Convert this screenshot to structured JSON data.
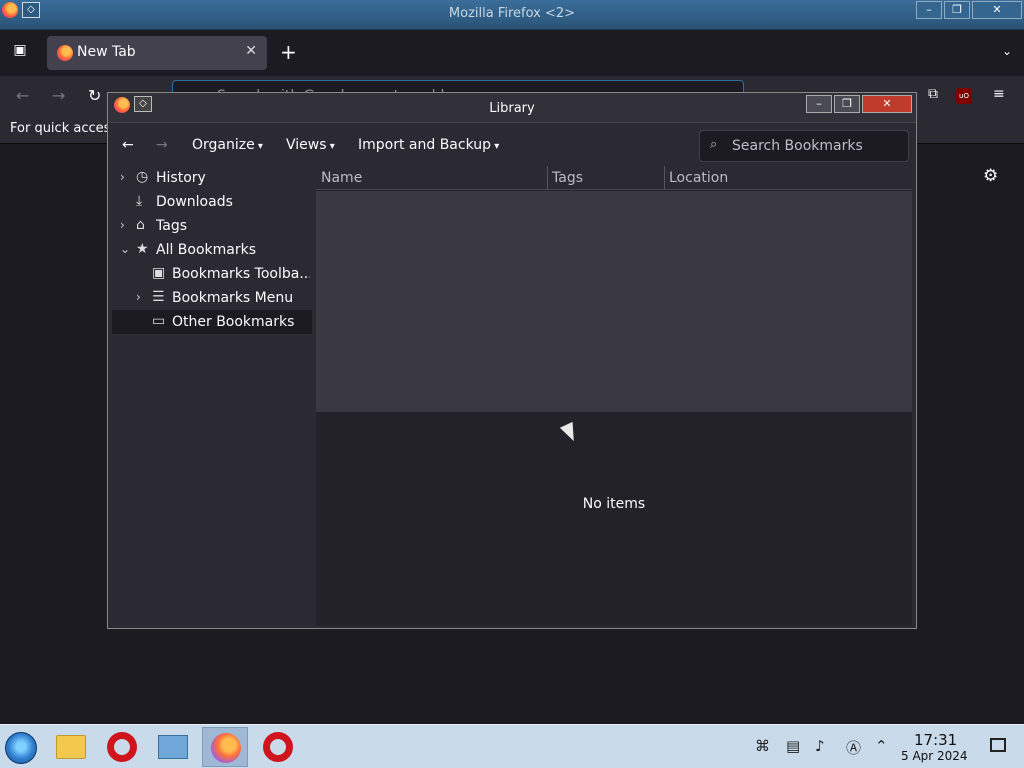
{
  "os_window": {
    "title": "Mozilla Firefox <2>",
    "controls": [
      "–",
      "❐",
      "✕"
    ]
  },
  "browser": {
    "tab": {
      "label": "New Tab",
      "close": "✕"
    },
    "new_tab": "+",
    "urlbar": {
      "placeholder": "Search with Google or enter address"
    },
    "bookmarks_bar_text": "For quick acces",
    "settings_icon": "gear-icon"
  },
  "library": {
    "title": "Library",
    "toolbar": {
      "back": "←",
      "forward": "→",
      "organize": "Organize",
      "views": "Views",
      "import_backup": "Import and Backup",
      "caret": "⌄",
      "search_placeholder": "Search Bookmarks"
    },
    "tree": [
      {
        "label": "History",
        "icon": "clock-icon",
        "expandable": true,
        "level": 0
      },
      {
        "label": "Downloads",
        "icon": "download-icon",
        "expandable": false,
        "level": 0
      },
      {
        "label": "Tags",
        "icon": "tag-icon",
        "expandable": true,
        "level": 0
      },
      {
        "label": "All Bookmarks",
        "icon": "star-icon",
        "expandable": true,
        "expanded": true,
        "level": 0
      },
      {
        "label": "Bookmarks Toolba...",
        "icon": "bookmarks-toolbar-icon",
        "expandable": false,
        "level": 1
      },
      {
        "label": "Bookmarks Menu",
        "icon": "bookmarks-menu-icon",
        "expandable": true,
        "level": 1
      },
      {
        "label": "Other Bookmarks",
        "icon": "folder-icon",
        "expandable": false,
        "level": 1,
        "selected": true
      }
    ],
    "columns": [
      "Name",
      "Tags",
      "Location"
    ],
    "details_text": "No items"
  },
  "taskbar": {
    "clock": {
      "time": "17:31",
      "date": "5 Apr 2024"
    },
    "apps": [
      "file-manager",
      "opera",
      "control-panel",
      "firefox",
      "opera"
    ],
    "active_app": "firefox"
  },
  "colors": {
    "accent": "#2f6f9f",
    "taskbar": "#c9daea",
    "opera_red": "#d0141e"
  }
}
